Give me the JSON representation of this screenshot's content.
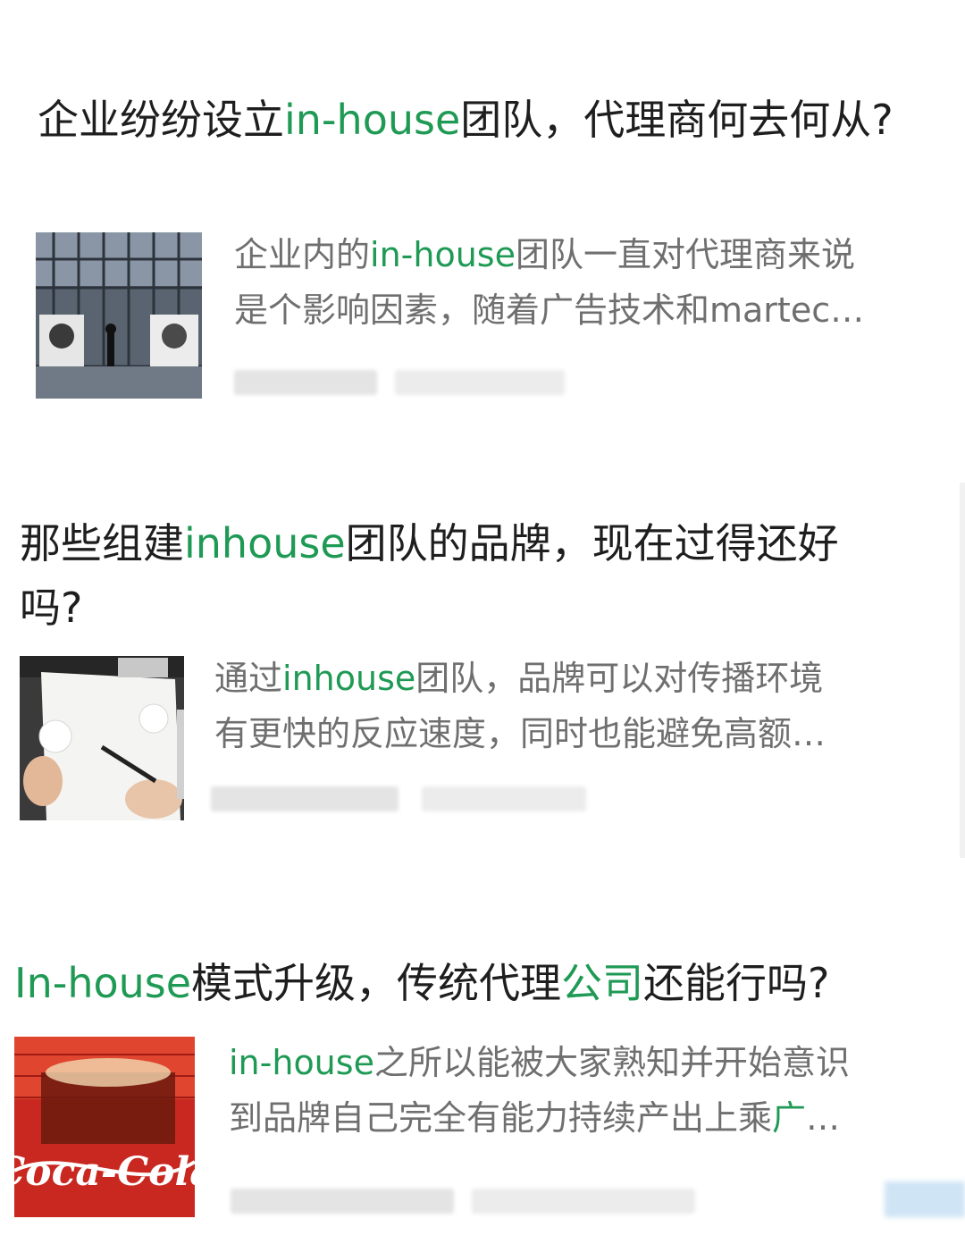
{
  "articles": [
    {
      "title_parts": [
        "企业纷纷设立",
        "in-house",
        "团队，代理商何去何从?"
      ],
      "summary_lines": [
        [
          "企业内的",
          "in-house",
          "团队一直对代理商来说"
        ],
        [
          "是个影响因素，随着广告技术和martec…",
          "",
          ""
        ]
      ],
      "thumbnail": "photo-portraits-wall"
    },
    {
      "title_parts": [
        "那些组建",
        "inhouse",
        "团队的品牌，现在过得还好吗?"
      ],
      "summary_lines": [
        [
          "通过",
          "inhouse",
          "团队，品牌可以对传播环境"
        ],
        [
          "有更快的反应速度，同时也能避免高额…",
          "",
          ""
        ]
      ],
      "thumbnail": "photo-hand-writing-paper"
    },
    {
      "title_parts": [
        "",
        "In-house",
        "模式升级，传统代理",
        "公司",
        "还能行吗?"
      ],
      "summary_lines": [
        [
          "",
          "in-house",
          "之所以能被大家熟知并开始意识"
        ],
        [
          "到品牌自己完全有能力持续产出上乘",
          "广",
          "…"
        ]
      ],
      "thumbnail": "photo-coca-cola",
      "thumbnail_text": "Coca-Cola"
    }
  ],
  "colors": {
    "highlight": "#1f9a55",
    "title": "#1e1e1e",
    "summary": "#6f6f6f"
  }
}
